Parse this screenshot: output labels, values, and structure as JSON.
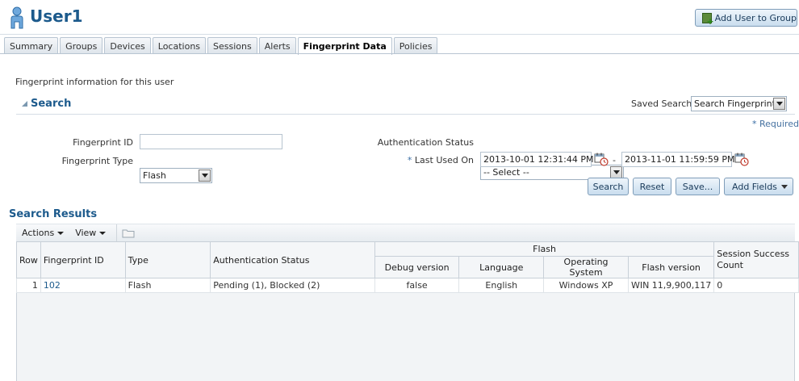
{
  "header": {
    "title": "User1",
    "add_user_label": "Add User to Group"
  },
  "tabs": [
    {
      "label": "Summary",
      "active": false
    },
    {
      "label": "Groups",
      "active": false
    },
    {
      "label": "Devices",
      "active": false
    },
    {
      "label": "Locations",
      "active": false
    },
    {
      "label": "Sessions",
      "active": false
    },
    {
      "label": "Alerts",
      "active": false
    },
    {
      "label": "Fingerprint Data",
      "active": true
    },
    {
      "label": "Policies",
      "active": false
    }
  ],
  "intro": "Fingerprint information for this user",
  "search": {
    "title": "Search",
    "saved_search_label": "Saved Search",
    "saved_search_value": "Search Fingerprints",
    "required_star": "*",
    "required_text": "Required",
    "fields": {
      "fingerprint_id_label": "Fingerprint ID",
      "fingerprint_id_value": "",
      "fingerprint_type_label": "Fingerprint Type",
      "fingerprint_type_value": "Flash",
      "auth_status_label": "Authentication Status",
      "auth_status_value": "-- Select --",
      "last_used_star": "*",
      "last_used_label": "Last Used On",
      "last_used_from": "2013-10-01 12:31:44 PM",
      "date_separator": "-",
      "last_used_to": "2013-11-01 11:59:59 PM"
    },
    "buttons": {
      "search": "Search",
      "reset": "Reset",
      "save": "Save...",
      "add_fields": "Add Fields"
    }
  },
  "results": {
    "title": "Search Results",
    "toolbar": {
      "actions": "Actions",
      "view": "View"
    },
    "columns": {
      "row": "Row",
      "fingerprint_id": "Fingerprint ID",
      "type": "Type",
      "auth_status": "Authentication Status",
      "flash_group": "Flash",
      "debug_version": "Debug version",
      "language": "Language",
      "os": "Operating System",
      "flash_version": "Flash version",
      "session_success": "Session Success Count"
    },
    "rows": [
      {
        "row": "1",
        "fingerprint_id": "102",
        "type": "Flash",
        "auth_status": "Pending (1), Blocked (2)",
        "debug_version": "false",
        "language": "English",
        "os": "Windows XP",
        "flash_version": "WIN 11,9,900,117",
        "session_success": "0"
      }
    ]
  },
  "icons": {
    "user": "user-icon",
    "add_to_group": "add-group-icon",
    "calendar": "calendar-icon",
    "folder": "folder-icon"
  },
  "colors": {
    "title_blue": "#1c5a8c",
    "button_border": "#7f9db9"
  }
}
